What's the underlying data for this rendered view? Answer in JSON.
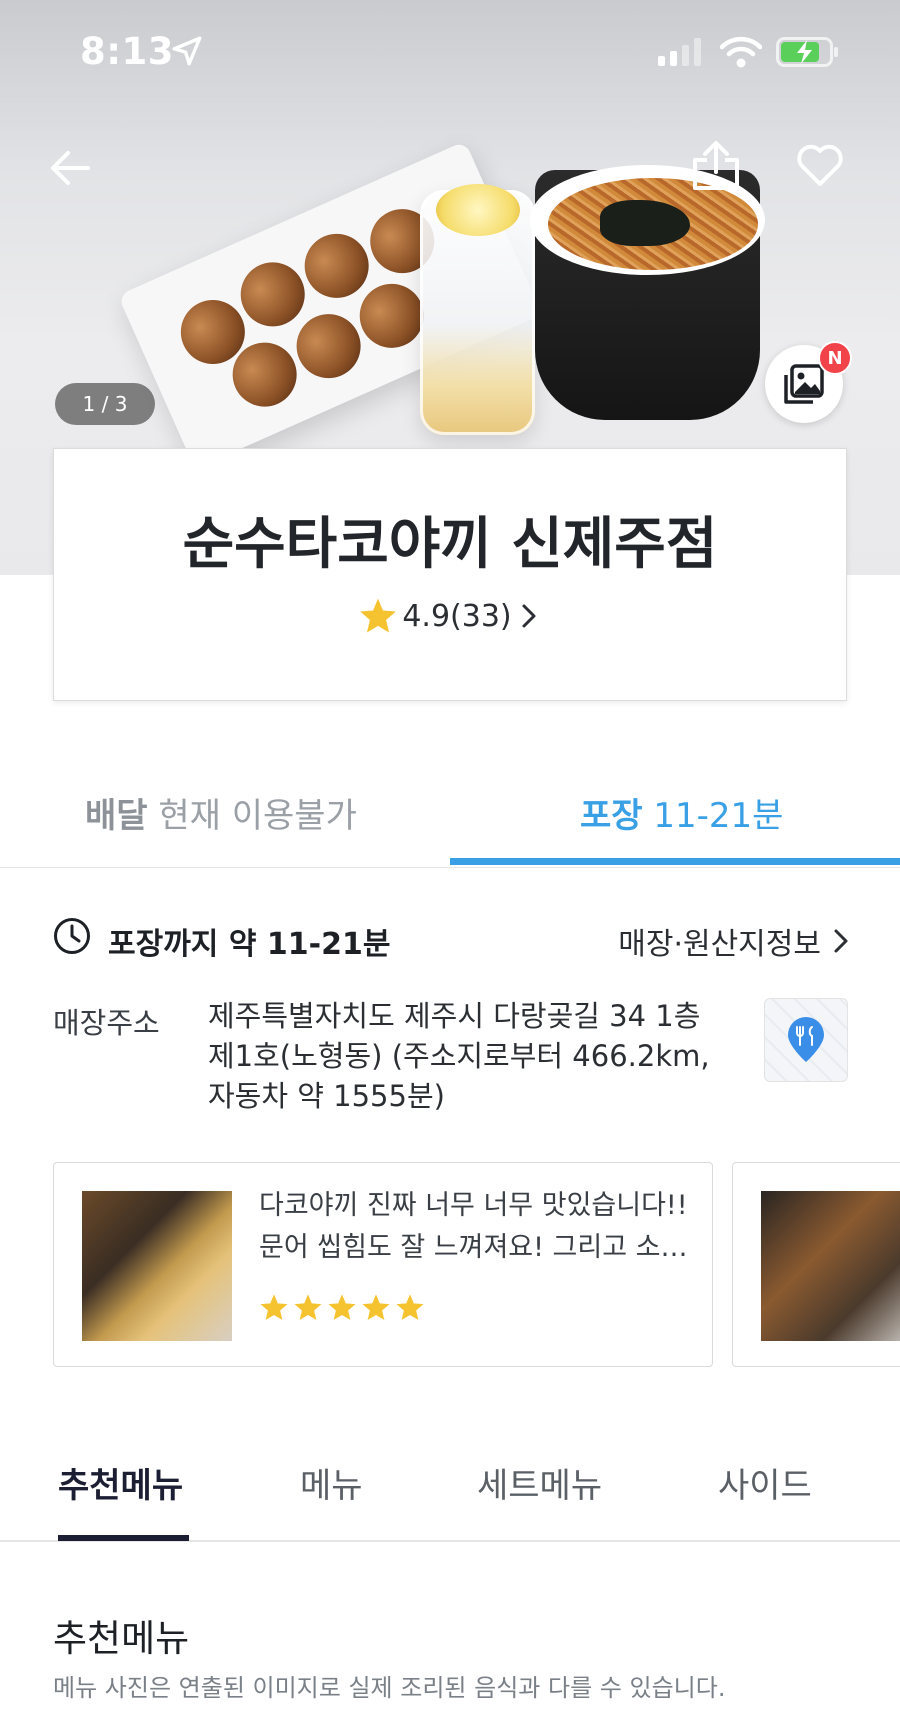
{
  "status_bar": {
    "time": "8:13"
  },
  "hero": {
    "image_counter": "1 / 3",
    "new_badge": "N",
    "icons": [
      "back-arrow-icon",
      "share-icon",
      "heart-icon",
      "gallery-icon"
    ]
  },
  "store": {
    "name": "순수타코야끼 신제주점",
    "rating": "4.9(33)"
  },
  "order_mode": {
    "delivery_label": "배달",
    "delivery_status": "현재 이용불가",
    "pickup_label": "포장",
    "pickup_time": "11-21분"
  },
  "pickup_info": {
    "text": "포장까지 약 11-21분",
    "origin_link": "매장·원산지정보"
  },
  "address": {
    "label": "매장주소",
    "lines": [
      "제주특별자치도 제주시 다랑곶길 34 1층",
      "제1호(노형동) (주소지로부터 466.2km,",
      "자동차 약 1555분)"
    ]
  },
  "reviews": [
    {
      "lines": [
        "다코야끼 진짜 너무 너무 맛있습니다!!",
        "문어 씹힘도 잘 느껴져요! 그리고 소…"
      ],
      "stars": 5
    }
  ],
  "menu_tabs": [
    "추천메뉴",
    "메뉴",
    "세트메뉴",
    "사이드"
  ],
  "section": {
    "title": "추천메뉴",
    "note": "메뉴 사진은 연출된 이미지로 실제 조리된 음식과 다를 수 있습니다."
  },
  "colors": {
    "accent": "#3aa0e6",
    "star": "#f5c330",
    "badge": "#f2424a",
    "dark_tab": "#1c1f33"
  }
}
